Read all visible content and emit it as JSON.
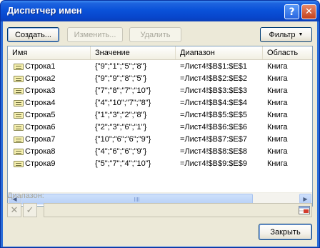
{
  "window": {
    "title": "Диспетчер имен",
    "help": "?",
    "close": "✕"
  },
  "toolbar": {
    "create": "Создать...",
    "edit": "Изменить...",
    "delete": "Удалить",
    "filter": "Фильтр"
  },
  "columns": [
    "Имя",
    "Значение",
    "Диапазон",
    "Область"
  ],
  "rows": [
    [
      "Строка1",
      "{\"9\";\"1\";\"5\";\"8\"}",
      "=Лист4!$B$1:$E$1",
      "Книга"
    ],
    [
      "Строка2",
      "{\"9\";\"9\";\"8\";\"5\"}",
      "=Лист4!$B$2:$E$2",
      "Книга"
    ],
    [
      "Строка3",
      "{\"7\";\"8\";\"7\";\"10\"}",
      "=Лист4!$B$3:$E$3",
      "Книга"
    ],
    [
      "Строка4",
      "{\"4\";\"10\";\"7\";\"8\"}",
      "=Лист4!$B$4:$E$4",
      "Книга"
    ],
    [
      "Строка5",
      "{\"1\";\"3\";\"2\";\"8\"}",
      "=Лист4!$B$5:$E$5",
      "Книга"
    ],
    [
      "Строка6",
      "{\"2\";\"3\";\"6\";\"1\"}",
      "=Лист4!$B$6:$E$6",
      "Книга"
    ],
    [
      "Строка7",
      "{\"10\";\"6\";\"6\";\"9\"}",
      "=Лист4!$B$7:$E$7",
      "Книга"
    ],
    [
      "Строка8",
      "{\"4\";\"6\";\"6\";\"9\"}",
      "=Лист4!$B$8:$E$8",
      "Книга"
    ],
    [
      "Строка9",
      "{\"5\";\"7\";\"4\";\"10\"}",
      "=Лист4!$B$9:$E$9",
      "Книга"
    ]
  ],
  "range": {
    "label": "Диапазон:",
    "value": ""
  },
  "footer": {
    "close": "Закрыть"
  },
  "colors": {
    "title_bar": "#0a52d9",
    "dialog_bg": "#ece9d8",
    "button_border": "#003c74"
  }
}
